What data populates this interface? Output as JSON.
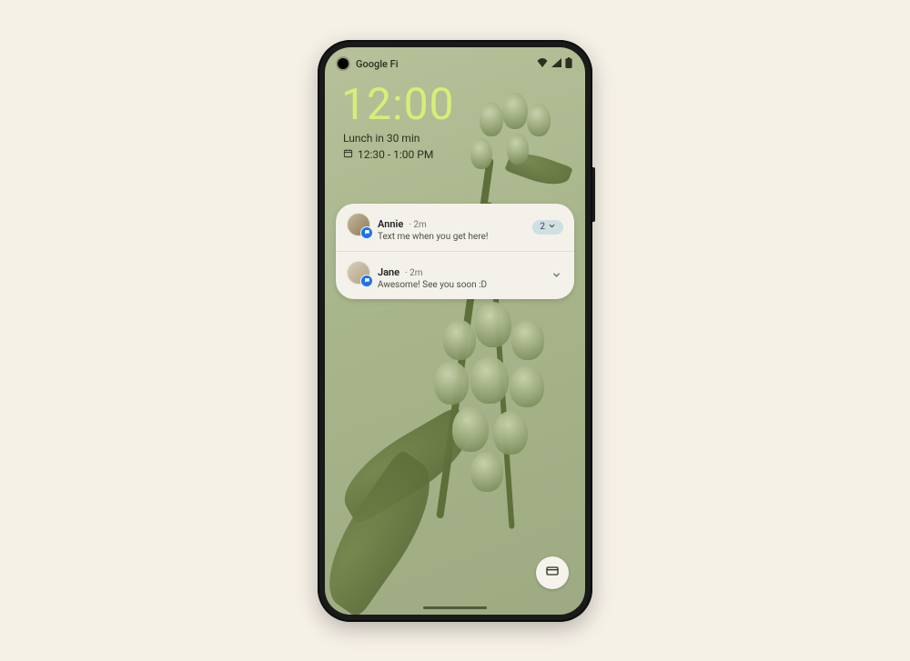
{
  "status": {
    "carrier": "Google Fi"
  },
  "clock": "12:00",
  "event": {
    "title": "Lunch in 30 min",
    "time": "12:30 - 1:00 PM"
  },
  "notifications": [
    {
      "sender": "Annie",
      "age": "· 2m",
      "message": "Text me when you get here!",
      "count": "2"
    },
    {
      "sender": "Jane",
      "age": "· 2m",
      "message": "Awesome! See you soon :D"
    }
  ]
}
